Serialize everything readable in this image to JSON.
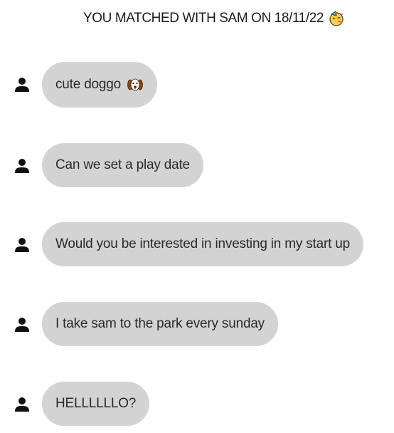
{
  "header": {
    "match_text": "YOU MATCHED WITH SAM ON 18/11/22",
    "emoji": "party-face-icon"
  },
  "messages": [
    {
      "text": "cute doggo",
      "emoji": "dog-face-icon"
    },
    {
      "text": "Can we set a play date"
    },
    {
      "text": "Would you be interested in investing in my start up"
    },
    {
      "text": "I take sam to the park every sunday"
    },
    {
      "text": "HELLLLLLO?"
    }
  ],
  "colors": {
    "bubble": "#d3d3d3",
    "text": "#2a2a2a",
    "avatar": "#111111"
  }
}
